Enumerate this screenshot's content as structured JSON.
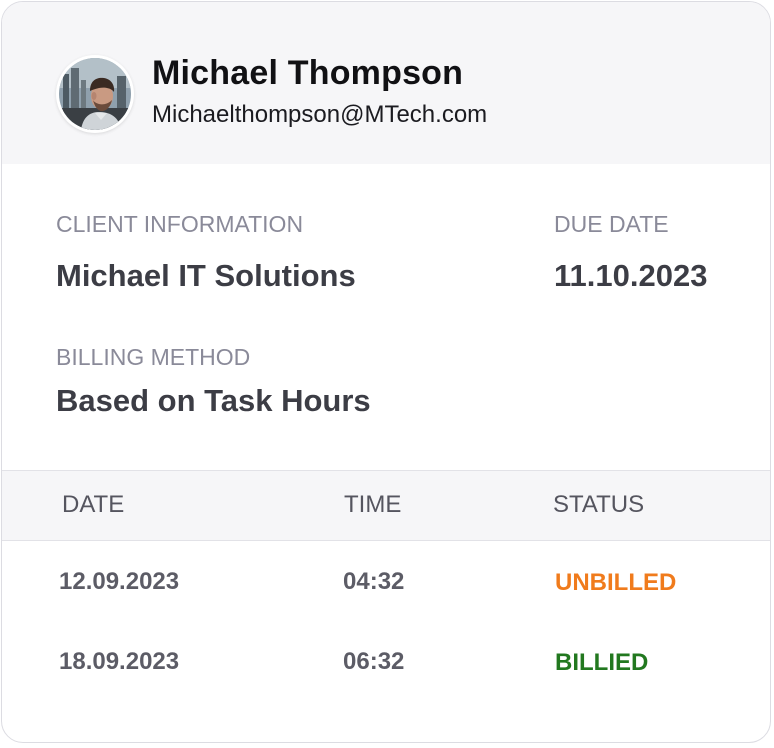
{
  "profile": {
    "name": "Michael Thompson",
    "email": "Michaelthompson@MTech.com",
    "avatar_icon": "user-avatar-photo"
  },
  "client": {
    "label": "CLIENT INFORMATION",
    "value": "Michael IT Solutions"
  },
  "due": {
    "label": "DUE DATE",
    "value": "11.10.2023"
  },
  "billing": {
    "label": "BILLING METHOD",
    "value": "Based on Task Hours"
  },
  "table": {
    "headers": [
      "DATE",
      "TIME",
      "STATUS"
    ],
    "rows": [
      {
        "date": "12.09.2023",
        "time": "04:32",
        "status": "UNBILLED",
        "status_color": "#f07b1c"
      },
      {
        "date": "18.09.2023",
        "time": "06:32",
        "status": "BILLIED",
        "status_color": "#22781f"
      }
    ]
  },
  "colors": {
    "header_bg": "#f6f6f8",
    "unbilled": "#f07b1c",
    "billed": "#22781f"
  }
}
